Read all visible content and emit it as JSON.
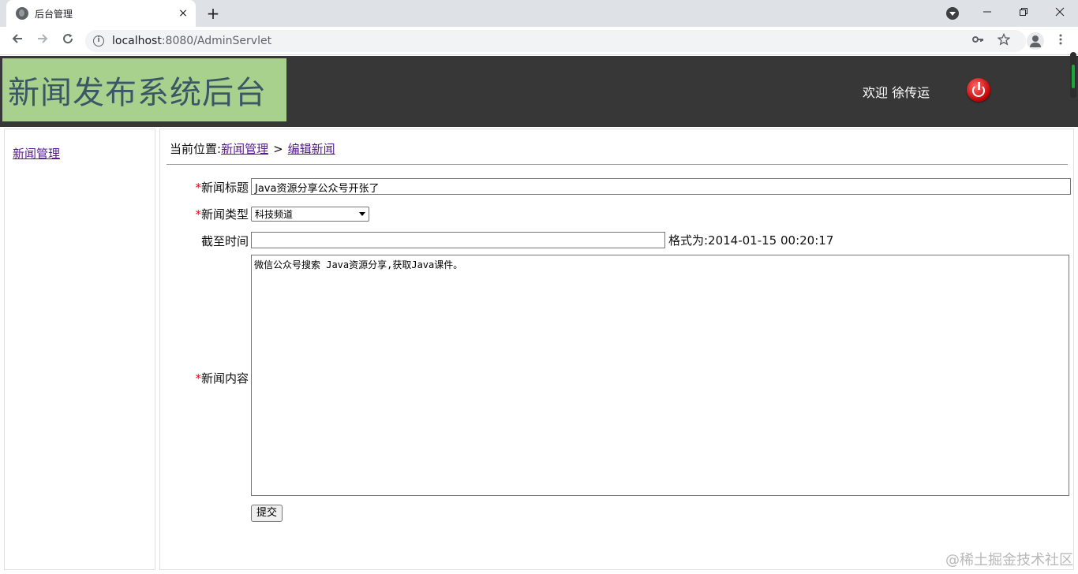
{
  "browser": {
    "tab_title": "后台管理",
    "tab_close": "×",
    "new_tab": "+",
    "url_host": "localhost",
    "url_path": ":8080/AdminServlet",
    "icons": [
      "globe-icon",
      "back-icon",
      "forward-icon",
      "reload-icon",
      "info-icon",
      "key-icon",
      "star-icon",
      "profile-icon",
      "menu-icon"
    ]
  },
  "header": {
    "logo": "新闻发布系统后台",
    "welcome": "欢迎 徐传运",
    "logo_bg": "#a9d18e",
    "header_bg": "#373737"
  },
  "sidebar": {
    "items": [
      {
        "label": "新闻管理"
      }
    ]
  },
  "breadcrumb": {
    "prefix": "当前位置:",
    "link1": "新闻管理",
    "sep": ">",
    "link2": "编辑新闻"
  },
  "form": {
    "title_label": "新闻标题",
    "title_value": "Java资源分享公众号开张了",
    "type_label": "新闻类型",
    "type_value": "科技频道",
    "deadline_label": "截至时间",
    "deadline_value": "",
    "deadline_hint": "格式为:2014-01-15 00:20:17",
    "content_label": "新闻内容",
    "content_value": "微信公众号搜索 Java资源分享,获取Java课件。",
    "required_mark": "*",
    "submit_label": "提交"
  },
  "watermark": "@稀土掘金技术社区"
}
